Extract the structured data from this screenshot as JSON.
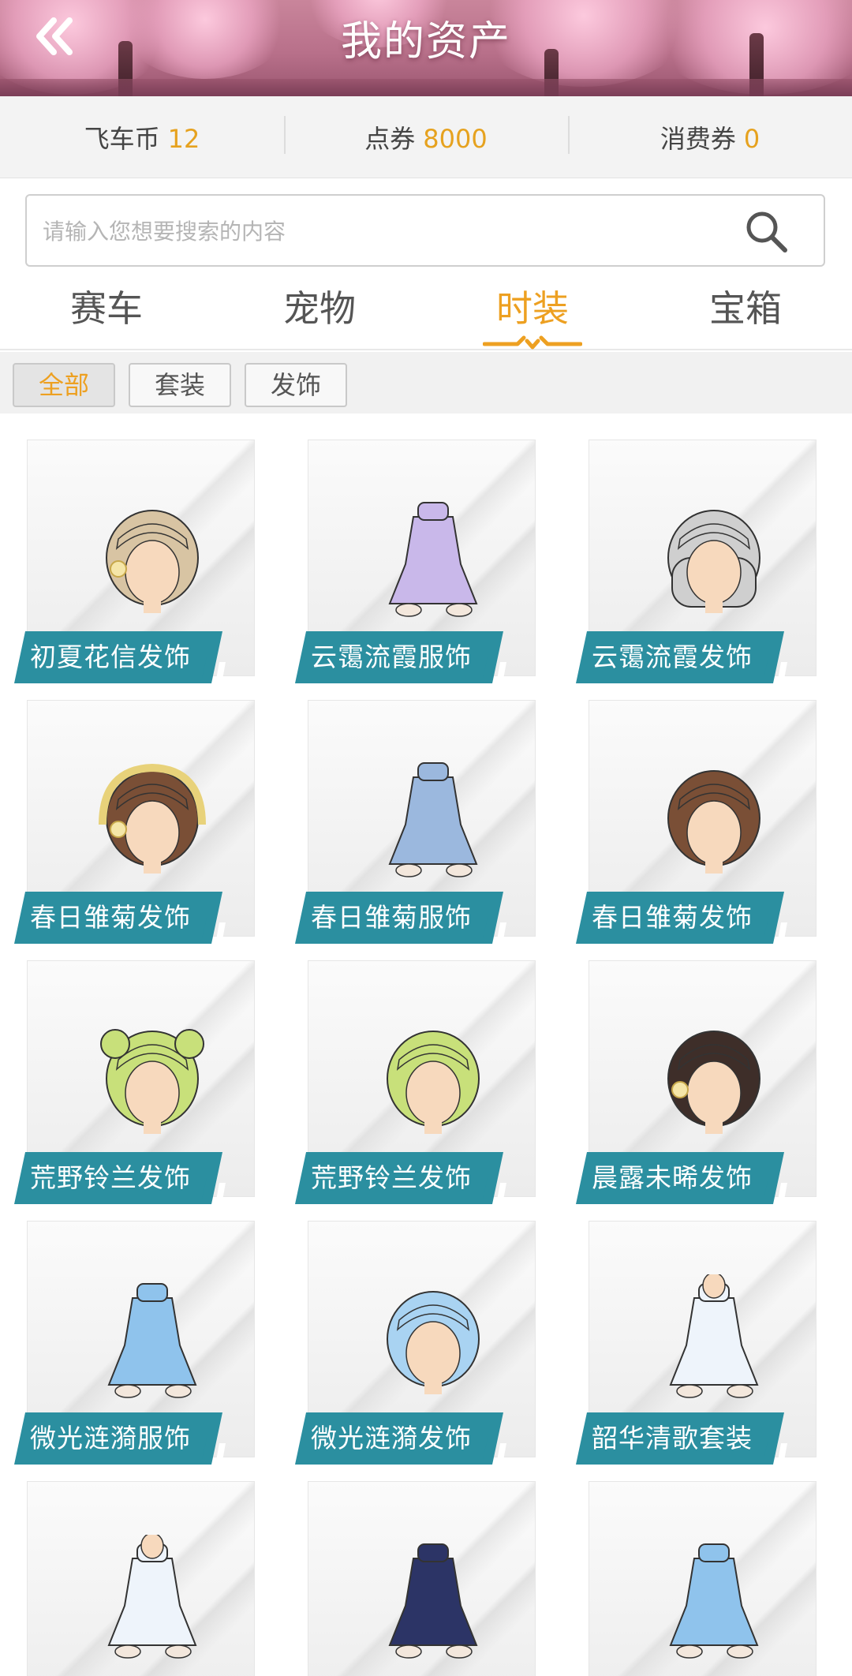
{
  "header": {
    "title": "我的资产"
  },
  "currencies": [
    {
      "name": "飞车币",
      "value": "12"
    },
    {
      "name": "点券",
      "value": "8000"
    },
    {
      "name": "消费券",
      "value": "0"
    }
  ],
  "search": {
    "placeholder": "请输入您想要搜索的内容",
    "value": ""
  },
  "tabs": [
    {
      "label": "赛车",
      "active": false
    },
    {
      "label": "宠物",
      "active": false
    },
    {
      "label": "时装",
      "active": true
    },
    {
      "label": "宝箱",
      "active": false
    }
  ],
  "filters": [
    {
      "label": "全部",
      "active": true
    },
    {
      "label": "套装",
      "active": false
    },
    {
      "label": "发饰",
      "active": false
    }
  ],
  "colors": {
    "accent": "#eda021",
    "label_bg": "#2b8fa0",
    "header_bg": "#b8708a"
  },
  "items": [
    {
      "name": "初夏花信发饰",
      "icon": "hair-wavy-beige-flower-icon"
    },
    {
      "name": "云霭流霞服饰",
      "icon": "outfit-lilac-dress-icon"
    },
    {
      "name": "云霭流霞发饰",
      "icon": "hair-long-silver-braid-icon"
    },
    {
      "name": "春日雏菊发饰",
      "icon": "hair-brown-daisy-hood-icon"
    },
    {
      "name": "春日雏菊服饰",
      "icon": "outfit-white-shirt-jeans-icon"
    },
    {
      "name": "春日雏菊发饰",
      "icon": "hair-short-brown-curly-icon"
    },
    {
      "name": "荒野铃兰发饰",
      "icon": "hair-green-buns-icon"
    },
    {
      "name": "荒野铃兰发饰",
      "icon": "hair-green-short-spiky-icon"
    },
    {
      "name": "晨露未晞发饰",
      "icon": "hair-dark-brown-flower-icon"
    },
    {
      "name": "微光涟漪服饰",
      "icon": "outfit-blue-swimsuit-icon"
    },
    {
      "name": "微光涟漪发饰",
      "icon": "hair-light-blue-bob-icon"
    },
    {
      "name": "韶华清歌套装",
      "icon": "suit-white-blue-gown-icon"
    },
    {
      "name": "",
      "icon": "suit-white-suit-boy-icon"
    },
    {
      "name": "",
      "icon": "outfit-navy-gothic-dress-icon"
    },
    {
      "name": "",
      "icon": "outfit-blue-floral-dress-icon"
    }
  ]
}
